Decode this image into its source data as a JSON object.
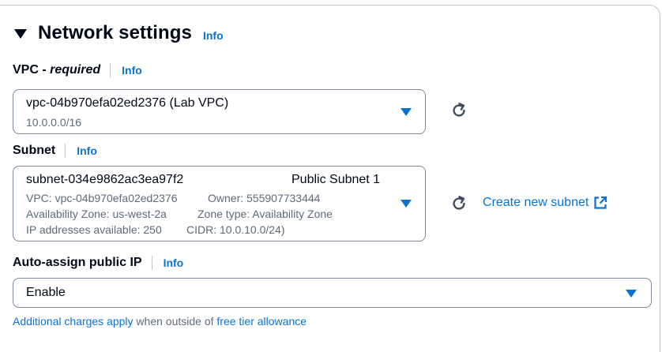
{
  "section": {
    "title": "Network settings",
    "info": "Info"
  },
  "vpc": {
    "label": "VPC - ",
    "label_required": "required",
    "info": "Info",
    "selected": "vpc-04b970efa02ed2376 (Lab VPC)",
    "cidr": "10.0.0.0/16"
  },
  "subnet": {
    "label": "Subnet",
    "info": "Info",
    "selected_id": "subnet-034e9862ac3ea97f2",
    "selected_name": "Public Subnet 1",
    "vpc": "VPC: vpc-04b970efa02ed2376",
    "owner": "Owner: 555907733444",
    "az": "Availability Zone: us-west-2a",
    "zone_type": "Zone type: Availability Zone",
    "ips": "IP addresses available: 250",
    "cidr": "CIDR: 10.0.10.0/24)",
    "create_link": "Create new subnet"
  },
  "auto_ip": {
    "label": "Auto-assign public IP",
    "info": "Info",
    "selected": "Enable"
  },
  "footer": {
    "link1": "Additional charges apply",
    "text": " when outside of ",
    "link2": "free tier allowance"
  },
  "colors": {
    "link": "#0972d3",
    "text": "#000716",
    "muted": "#5f6b7a",
    "border": "#7d8998"
  },
  "icons": [
    "caret-down-icon",
    "refresh-icon",
    "external-link-icon",
    "dropdown-triangle-icon"
  ]
}
